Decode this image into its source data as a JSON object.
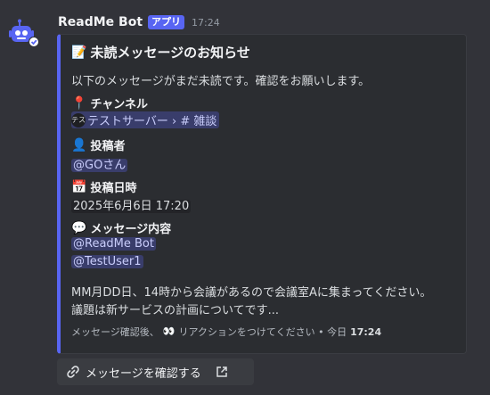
{
  "header": {
    "bot_name": "ReadMe Bot",
    "badge": "アプリ",
    "time": "17:24"
  },
  "embed": {
    "accent_color": "#5865f2",
    "title_emoji": "📝",
    "title": "未読メッセージのお知らせ",
    "description": "以下のメッセージがまだ未読です。確認をお願いします。",
    "fields": {
      "channel": {
        "emoji": "📍",
        "name": "チャンネル",
        "server_icon_text": "テス",
        "value": "テストサーバー › # 雑談"
      },
      "author": {
        "emoji": "👤",
        "name": "投稿者",
        "value": "@GOさん"
      },
      "date": {
        "emoji": "📅",
        "name": "投稿日時",
        "value": "2025年6月6日 17:20"
      },
      "content": {
        "emoji": "💬",
        "name": "メッセージ内容",
        "mentions": [
          "@ReadMe Bot",
          "@TestUser1"
        ],
        "line1": "MM月DD日、14時から会議があるので会議室Aに集まってください。",
        "line2": "議題は新サービスの計画についてです..."
      }
    },
    "footer": {
      "text_before": "メッセージ確認後、",
      "emoji": "👀",
      "text_after": "リアクションをつけてください • 今日",
      "time": "17:24"
    }
  },
  "button": {
    "icon": "link-icon",
    "label": "メッセージを確認する",
    "external_icon": "external-link-icon"
  }
}
